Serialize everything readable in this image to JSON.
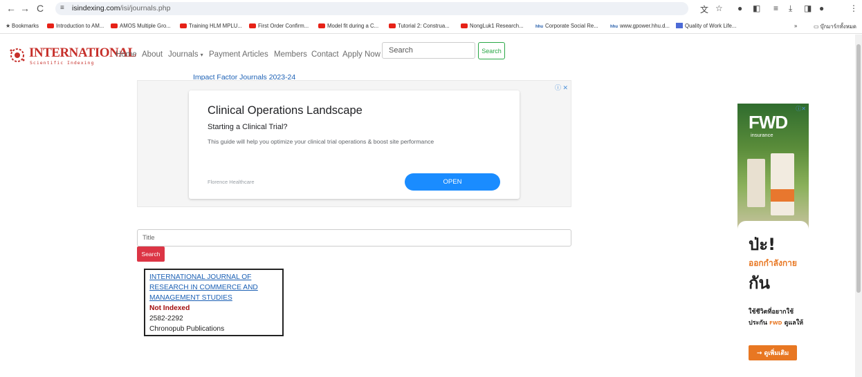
{
  "browser": {
    "url_host": "isindexing.com",
    "url_path": "/isi/journals.php",
    "bookmarks": [
      {
        "label": "Bookmarks",
        "icon": "star-icon"
      },
      {
        "label": "Introduction to AM...",
        "icon": "youtube-icon"
      },
      {
        "label": "AMOS Multiple Gro...",
        "icon": "youtube-icon"
      },
      {
        "label": "Training HLM MPLU...",
        "icon": "youtube-icon"
      },
      {
        "label": "First Order Confirm...",
        "icon": "youtube-icon"
      },
      {
        "label": "Model fit during a C...",
        "icon": "youtube-icon"
      },
      {
        "label": "Tutorial 2: Construa...",
        "icon": "youtube-icon"
      },
      {
        "label": "NongLuk1 Research...",
        "icon": "youtube-icon"
      },
      {
        "label": "Corporate Social Re...",
        "icon": "hhu-icon"
      },
      {
        "label": "www.gpower.hhu.d...",
        "icon": "hhu-icon"
      },
      {
        "label": "Quality of Work Life...",
        "icon": "bookmark-icon"
      },
      {
        "label": "บุ๊กมาร์กทั้งหมด",
        "icon": "folder-icon"
      }
    ],
    "overflow_label": "»"
  },
  "site": {
    "logo_title": "INTERNATIONAL",
    "logo_subtitle": "Scientific Indexing",
    "nav": [
      "Home",
      "About",
      "Journals",
      "Payment",
      "Articles",
      "Members",
      "Contact",
      "Apply Now"
    ],
    "search_placeholder": "Search",
    "search_button": "Search"
  },
  "ad": {
    "top_link": "Impact Factor Journals 2023-24",
    "headline": "Clinical Operations Landscape",
    "subheadline": "Starting a Clinical Trial?",
    "body": "This guide will help you optimize your clinical trial operations & boost site performance",
    "advertiser": "Florence Healthcare",
    "cta": "OPEN"
  },
  "search_form": {
    "title_placeholder": "Title",
    "button": "Search"
  },
  "result": {
    "link_lines": [
      "INTERNATIONAL JOURNAL OF",
      "RESEARCH IN COMMERCE AND",
      "MANAGEMENT STUDIES"
    ],
    "status": "Not Indexed",
    "issn": "2582-2292",
    "publisher": "Chronopub Publications"
  },
  "side_ad": {
    "brand": "FWD",
    "brand_sub": "insurance",
    "line1": "ป่ะ!",
    "line2": "ออกกำลังกาย",
    "line3": "กัน",
    "line4a": "ใช้ชีวิตที่อยากใช้",
    "line4b_pre": "ประกัน",
    "line4b_brand": "FWD",
    "line4b_post": "ดูแลให้",
    "cta": "→ ดูเพิ่มเติม"
  },
  "colors": {
    "brand_red": "#c62f2a",
    "link_blue": "#1a5fb4",
    "danger": "#dc3545",
    "success": "#28a745",
    "fwd_orange": "#e87722"
  }
}
